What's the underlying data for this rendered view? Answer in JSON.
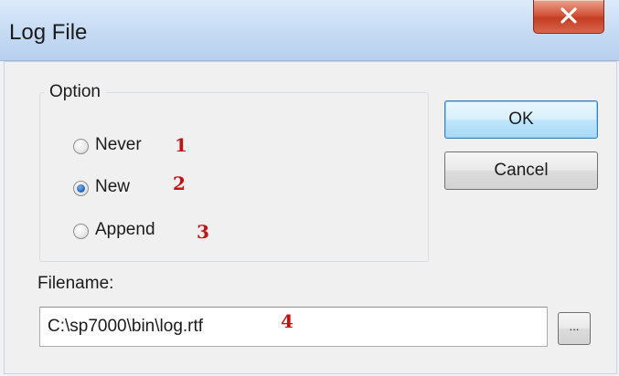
{
  "window": {
    "title": "Log File",
    "close_icon": "close-x-icon"
  },
  "option_group": {
    "label": "Option",
    "selected": "New",
    "options": [
      {
        "label": "Never",
        "checked": false,
        "annotation": "1"
      },
      {
        "label": "New",
        "checked": true,
        "annotation": "2"
      },
      {
        "label": "Append",
        "checked": false,
        "annotation": "3"
      }
    ]
  },
  "buttons": {
    "ok_label": "OK",
    "cancel_label": "Cancel",
    "browse_label": "..."
  },
  "filename": {
    "label": "Filename:",
    "value": "C:\\sp7000\\bin\\log.rtf",
    "annotation": "4"
  },
  "colors": {
    "annotation": "#c81010",
    "close_button": "#c43d23",
    "default_button_border": "#3c7fb1"
  }
}
